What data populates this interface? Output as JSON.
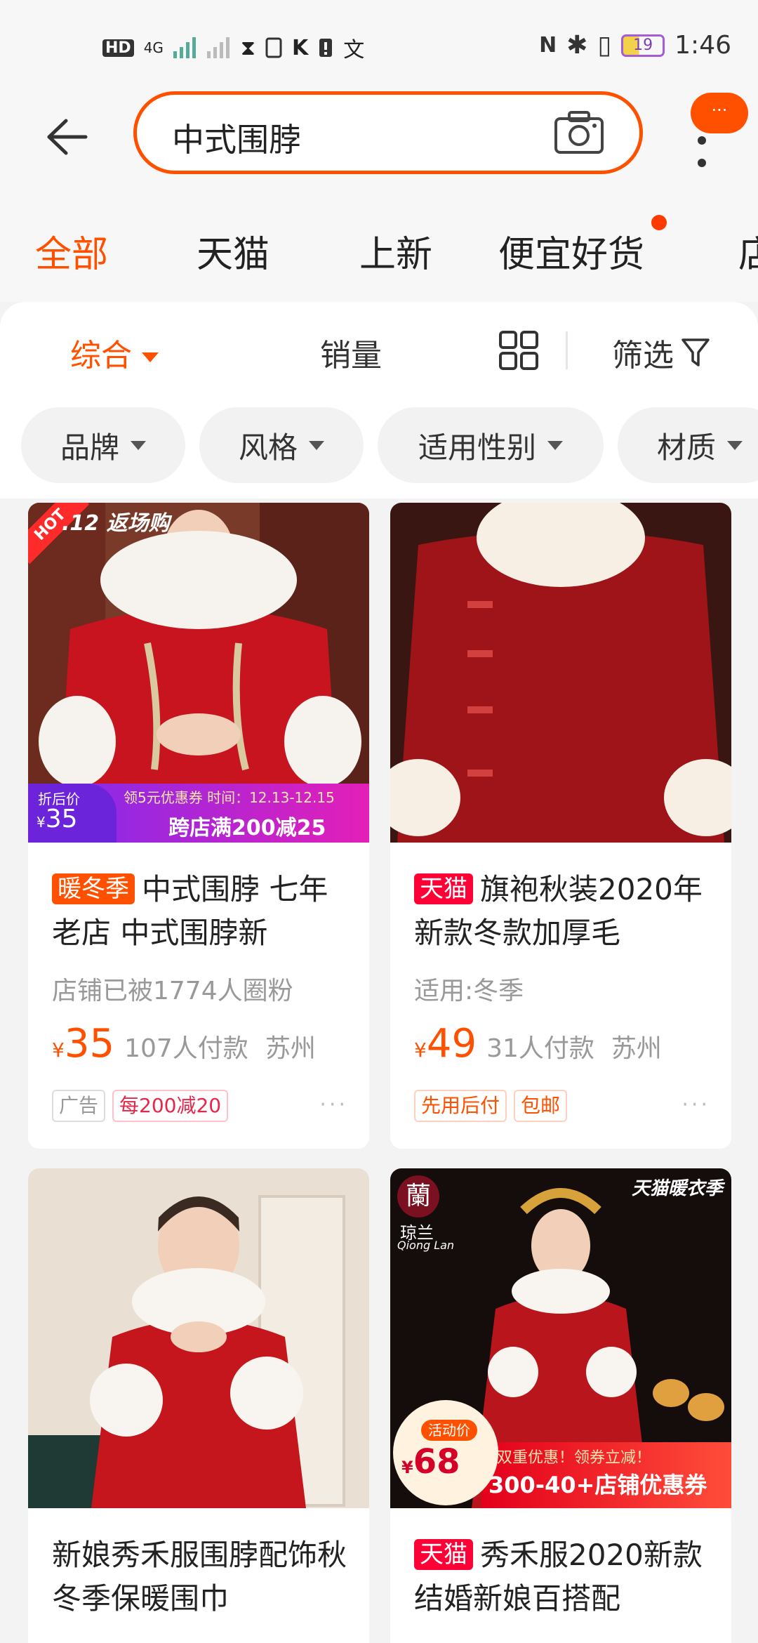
{
  "status_bar": {
    "left_icons": [
      "HD",
      "4G",
      "signal-1",
      "signal-2",
      "hourglass",
      "note",
      "K",
      "alert",
      "translate"
    ],
    "hd_label": "HD",
    "network_label": "4G",
    "k_label": "K",
    "battery": "19",
    "time": "1:46"
  },
  "header": {
    "search_value": "中式围脖",
    "more_bubble": "···"
  },
  "tabs": [
    {
      "label": "全部",
      "active": true
    },
    {
      "label": "天猫",
      "active": false
    },
    {
      "label": "上新",
      "active": false
    },
    {
      "label": "便宜好货",
      "active": false,
      "dot": true
    },
    {
      "label": "店",
      "active": false
    }
  ],
  "sort": {
    "items": [
      "综合",
      "销量",
      "筛选"
    ],
    "active": "综合"
  },
  "chips": [
    "品牌",
    "风格",
    "适用性别",
    "材质"
  ],
  "products": [
    {
      "badge": "暖冬季",
      "badge_style": "warm",
      "title": "中式围脖 七年老店 中式围脖新",
      "subtitle": "店铺已被1774人圈粉",
      "yen": "¥",
      "price": "35",
      "sold": "107人付款",
      "location": "苏州",
      "tags": [
        "广告",
        "每200减20"
      ],
      "more": "···",
      "overlay": {
        "hot": "HOT",
        "promo": ".12 返场购",
        "coupon_label": "折后价",
        "coupon_yen": "¥",
        "coupon_price": "35",
        "coupon_line": "领5元优惠券   时间：12.13-12.15",
        "coupon_main": "跨店满200减25"
      }
    },
    {
      "badge": "天猫",
      "badge_style": "tmall",
      "title": "旗袍秋装2020年新款冬款加厚毛",
      "subtitle": "适用:冬季",
      "yen": "¥",
      "price": "49",
      "sold": "31人付款",
      "location": "苏州",
      "tags": [
        "先用后付",
        "包邮"
      ],
      "more": "···"
    },
    {
      "title": "新娘秀禾服围脖配饰秋冬季保暖围巾"
    },
    {
      "badge": "天猫",
      "badge_style": "tmall",
      "title": "秀禾服2020新款结婚新娘百搭配",
      "overlay": {
        "seal": "蘭",
        "brand_cn": "琼兰",
        "brand_en": "Qiong Lan",
        "season": "天猫暖衣季",
        "act_label": "活动价",
        "act_yen": "¥",
        "act_price": "68",
        "band_line": "双重优惠！领券立减！",
        "band_main": "300-40+店铺优惠券"
      }
    }
  ],
  "colors": {
    "accent": "#ff5000",
    "tmall": "#ff0036",
    "text": "#222222",
    "muted": "#999999",
    "background": "#f3f3f3"
  }
}
